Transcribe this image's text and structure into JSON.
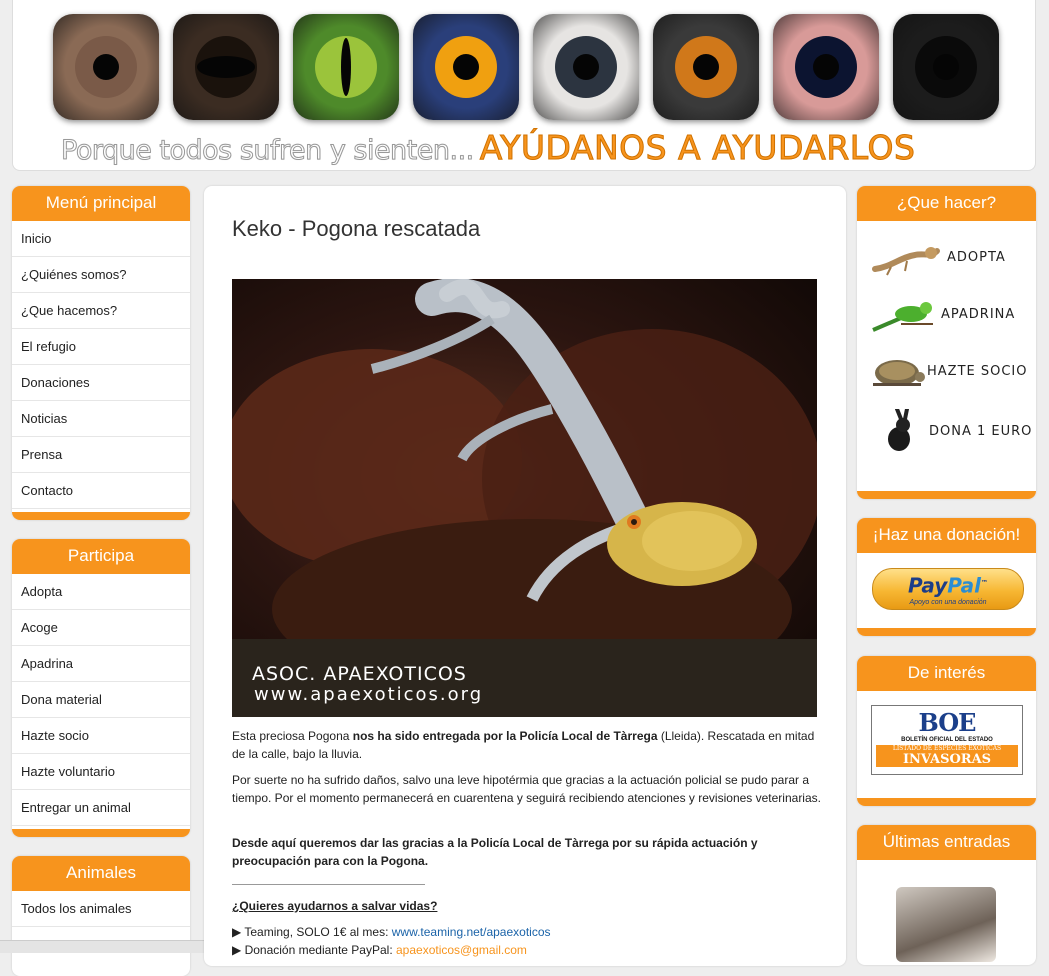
{
  "header": {
    "eyes": [
      {
        "name": "horse",
        "bg": "#8a6a55",
        "iris": "#7a5a48",
        "pupil_shape": "round"
      },
      {
        "name": "cow",
        "bg": "#3b2c22",
        "iris": "#1a120c",
        "pupil_shape": "wide"
      },
      {
        "name": "reptile",
        "bg": "#4e8a2a",
        "iris": "#9bc43b",
        "pupil_shape": "slit"
      },
      {
        "name": "bird",
        "bg": "#2a3f7a",
        "iris": "#f0a010",
        "pupil_shape": "round"
      },
      {
        "name": "rodent",
        "bg": "#e6e4e2",
        "iris": "#2c3440",
        "pupil_shape": "round"
      },
      {
        "name": "dog",
        "bg": "#3a3a3a",
        "iris": "#d0781a",
        "pupil_shape": "round"
      },
      {
        "name": "seal",
        "bg": "#d89a98",
        "iris": "#0c1430",
        "pupil_shape": "round"
      },
      {
        "name": "black-cat",
        "bg": "#1c1c1c",
        "iris": "#0a0a0a",
        "pupil_shape": "round"
      }
    ],
    "slogan_part1": "Porque todos sufren y sienten...",
    "slogan_part2": "AYÚDANOS A AYUDARLOS"
  },
  "menu_principal": {
    "title": "Menú principal",
    "items": [
      "Inicio",
      "¿Quiénes somos?",
      "¿Que hacemos?",
      "El refugio",
      "Donaciones",
      "Noticias",
      "Prensa",
      "Contacto"
    ]
  },
  "participa": {
    "title": "Participa",
    "items": [
      "Adopta",
      "Acoge",
      "Apadrina",
      "Dona material",
      "Hazte socio",
      "Hazte voluntario",
      "Entregar un animal"
    ]
  },
  "animales": {
    "title": "Animales",
    "items": [
      "Todos los animales"
    ]
  },
  "article": {
    "title": "Keko - Pogona rescatada",
    "watermark1": "ASOC. APAEXOTICOS",
    "watermark2": "www.apaexoticos.org",
    "p1_a": "Esta preciosa Pogona ",
    "p1_b": "nos ha sido entregada por la Policía Local de Tàrrega",
    "p1_c": " (Lleida). Rescatada en mitad de la calle, bajo la lluvia.",
    "p2": "Por suerte no ha sufrido daños, salvo una leve hipotérmia que gracias a la actuación policial se pudo parar a tiempo. Por el momento permanecerá en cuarentena y seguirá recibiendo atenciones y revisiones veterinarias.",
    "p3": "Desde aquí queremos dar las gracias a la Policía Local de Tàrrega por su rápida actuación y preocupación para con la Pogona.",
    "help_heading": "¿Quieres ayudarnos a salvar vidas?",
    "bullet_marker": "▶",
    "teaming_text": " Teaming, SOLO 1€ al mes: ",
    "teaming_link": "www.teaming.net/apaexoticos",
    "paypal_text": " Donación mediante PayPal: ",
    "paypal_link": "apaexoticos@gmail.com"
  },
  "que_hacer": {
    "title": "¿Que hacer?",
    "actions": [
      {
        "label": "ADOPTA",
        "icon": "bearded-dragon-icon"
      },
      {
        "label": "APADRINA",
        "icon": "parakeet-icon"
      },
      {
        "label": "HAZTE SOCIO",
        "icon": "tortoise-icon"
      },
      {
        "label": "DONA 1 EURO",
        "icon": "rabbit-icon"
      }
    ]
  },
  "donacion": {
    "title": "¡Haz una donación!",
    "paypal_word1": "Pay",
    "paypal_word2": "Pal",
    "paypal_tm": "™",
    "paypal_sub": "Apoyo con una donación"
  },
  "interes": {
    "title": "De interés",
    "boe_logo": "BOE",
    "boe_line1": "BOLETÍN OFICIAL DEL ESTADO",
    "boe_line2": "LISTADO DE ESPECIES EXÓTICAS",
    "boe_line3": "INVASORAS"
  },
  "ultimas": {
    "title": "Últimas entradas"
  },
  "colors": {
    "accent": "#f7941d",
    "link": "#1b63a8"
  }
}
